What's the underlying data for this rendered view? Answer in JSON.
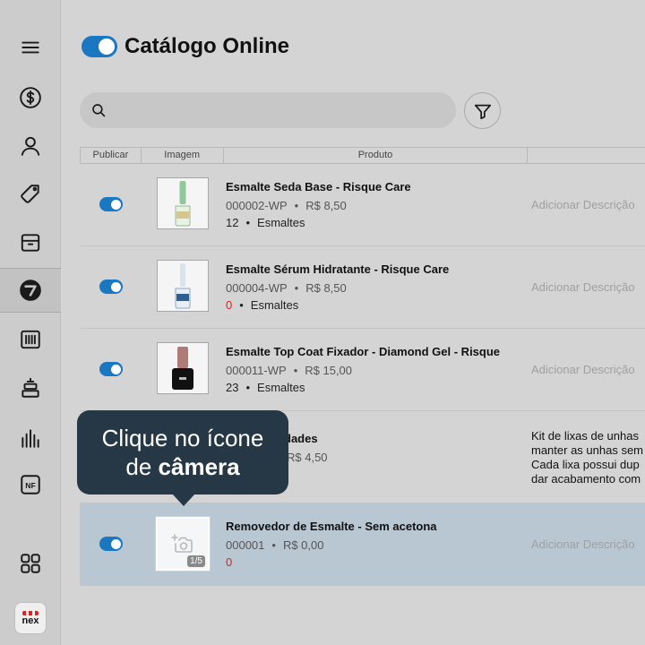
{
  "header": {
    "title": "Catálogo Online"
  },
  "search": {
    "placeholder": ""
  },
  "table": {
    "columns": [
      "Publicar",
      "Imagem",
      "Produto"
    ]
  },
  "rows": [
    {
      "name": "Esmalte Seda Base - Risque Care",
      "code": "000002-WP",
      "price": "R$ 8,50",
      "stock": "12",
      "category": "Esmaltes",
      "description": "Adicionar Descrição"
    },
    {
      "name": "Esmalte Sérum Hidratante - Risque Care",
      "code": "000004-WP",
      "price": "R$ 8,50",
      "stock": "0",
      "category": "Esmaltes",
      "description": "Adicionar Descrição"
    },
    {
      "name": "Esmalte Top Coat Fixador - Diamond Gel - Risque",
      "code": "000011-WP",
      "price": "R$ 15,00",
      "stock": "23",
      "category": "Esmaltes",
      "description": "Adicionar Descrição"
    },
    {
      "name": "nha - 3 unidades",
      "price": "R$ 4,50",
      "description": "Kit de lixas de unhas\nmanter as unhas sem\nCada lixa possui dup\ndar acabamento com"
    },
    {
      "name": "Removedor de Esmalte - Sem acetona",
      "code": "000001",
      "price": "R$ 0,00",
      "stock": "0",
      "description": "Adicionar Descrição",
      "image_count": "1/5"
    }
  ],
  "tooltip": {
    "line1": "Clique no ícone",
    "line2_prefix": "de ",
    "line2_bold": "câmera"
  },
  "brand": {
    "logo_text": "nex"
  },
  "colors": {
    "accent": "#1a78c2",
    "tooltip_bg": "#263746",
    "zero_stock": "#e02020",
    "highlight_row": "#b9c7d2"
  }
}
